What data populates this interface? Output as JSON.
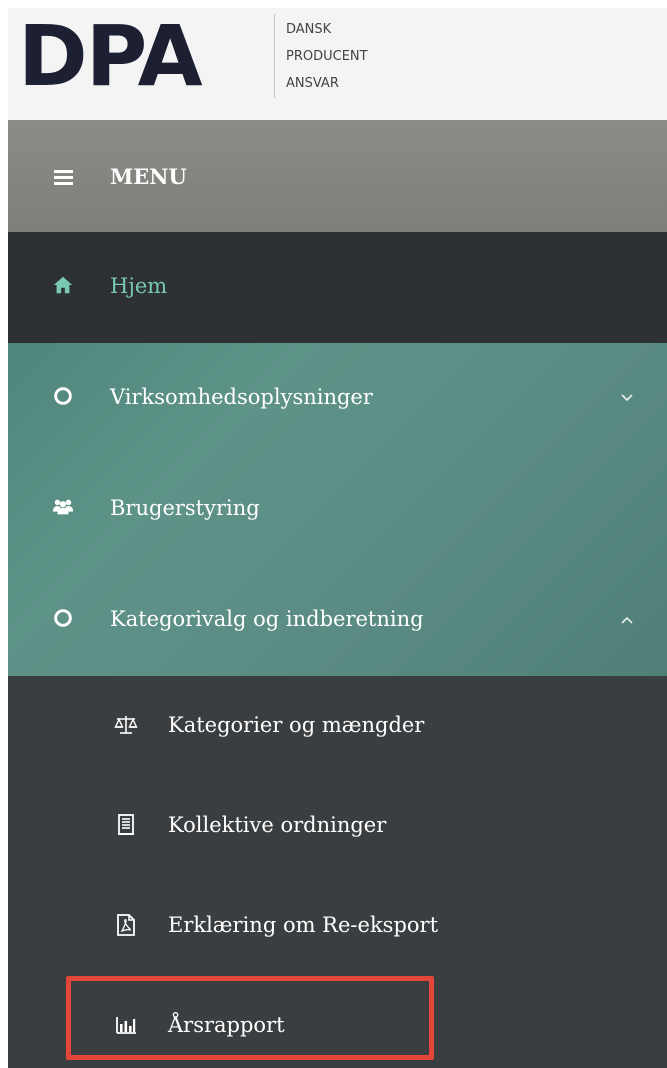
{
  "logo": {
    "mark": "DPA",
    "lines": [
      "DANSK",
      "PRODUCENT",
      "ANSVAR"
    ]
  },
  "menu": {
    "label": "MENU",
    "icon": "hamburger-icon"
  },
  "nav": {
    "items": [
      {
        "label": "Hjem",
        "icon": "home-icon",
        "active": true
      },
      {
        "label": "Virksomhedsoplysninger",
        "icon": "circle-icon",
        "expanded": false
      },
      {
        "label": "Brugerstyring",
        "icon": "users-icon"
      },
      {
        "label": "Kategorivalg og indberetning",
        "icon": "circle-icon",
        "expanded": true
      }
    ],
    "subitems": [
      {
        "label": "Kategorier og mængder",
        "icon": "scale-icon"
      },
      {
        "label": "Kollektive ordninger",
        "icon": "receipt-icon"
      },
      {
        "label": "Erklæring om Re-eksport",
        "icon": "pdf-icon"
      },
      {
        "label": "Årsrapport",
        "icon": "bar-chart-icon",
        "highlighted": true
      }
    ]
  },
  "colors": {
    "home_active": "#78c9b0",
    "teal": "#5b8c84",
    "dark": "#2d3134",
    "submenu": "#3b3e40",
    "highlight": "#e5463c"
  }
}
